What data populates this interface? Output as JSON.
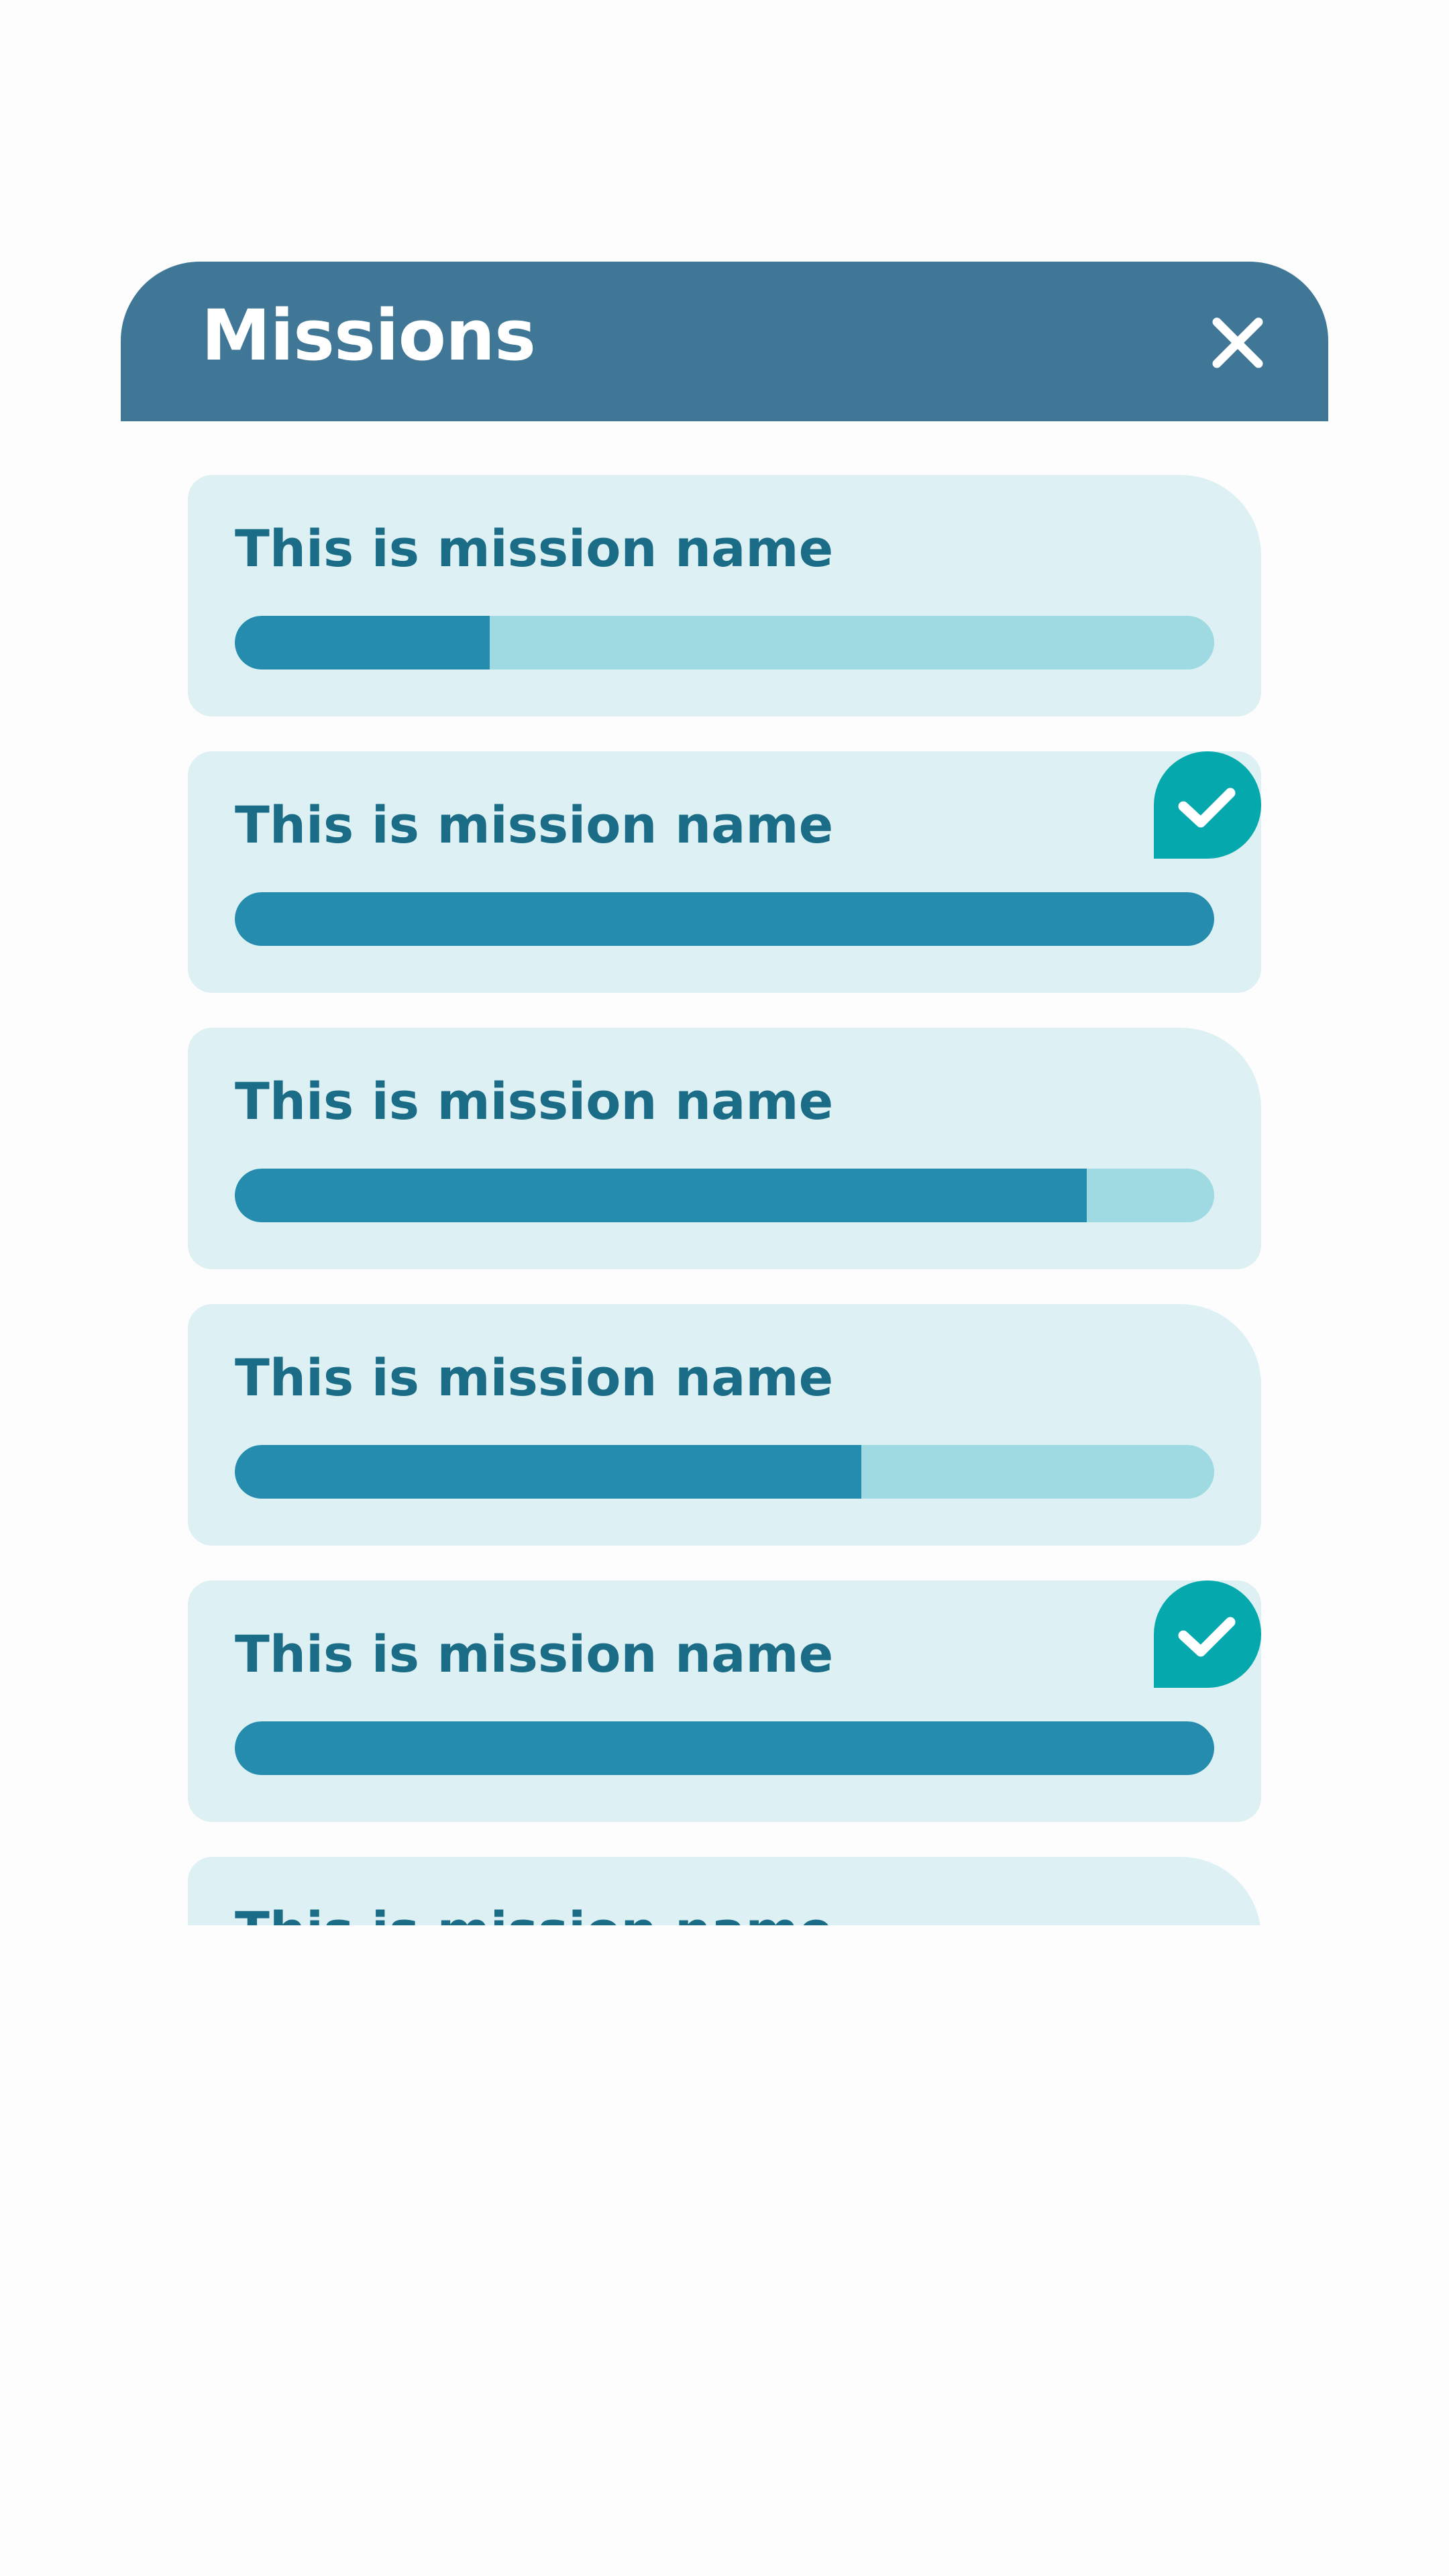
{
  "header": {
    "title": "Missions",
    "close_icon": "close-icon"
  },
  "colors": {
    "header_bg": "#417796",
    "card_bg": "#ddf1f4",
    "title_text": "#1b6c86",
    "bar_fill": "#258cad",
    "bar_track": "#9fdae3",
    "badge": "#05a9ad"
  },
  "missions": [
    {
      "name": "This is mission name",
      "progress": 0.26,
      "completed": false
    },
    {
      "name": "This is mission name",
      "progress": 1.0,
      "completed": true,
      "badge_icon": "check-icon"
    },
    {
      "name": "This is mission name",
      "progress": 0.87,
      "completed": false
    },
    {
      "name": "This is mission name",
      "progress": 0.64,
      "completed": false
    },
    {
      "name": "This is mission name",
      "progress": 1.0,
      "completed": true,
      "badge_icon": "check-icon"
    },
    {
      "name": "This is mission name",
      "progress": null,
      "completed": false
    }
  ]
}
